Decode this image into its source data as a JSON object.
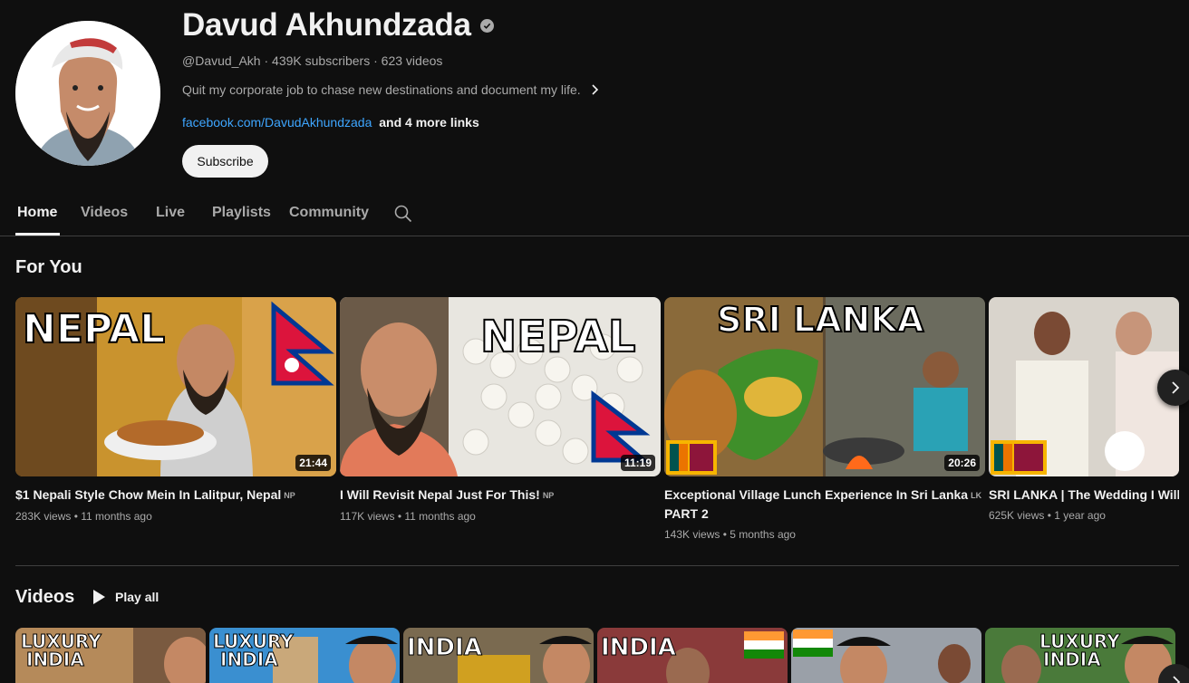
{
  "channel": {
    "name": "Davud Akhundzada",
    "handle": "@Davud_Akh",
    "subscribers": "439K subscribers",
    "videos_count": "623 videos",
    "description": "Quit my corporate job to chase new destinations and document my life.",
    "link": "facebook.com/DavudAkhundzada",
    "more_links": "and 4 more links",
    "subscribe_label": "Subscribe",
    "verified_icon": "verified-check-icon"
  },
  "tabs": [
    {
      "label": "Home",
      "active": true
    },
    {
      "label": "Videos"
    },
    {
      "label": "Live"
    },
    {
      "label": "Playlists"
    },
    {
      "label": "Community"
    }
  ],
  "for_you": {
    "title": "For You",
    "items": [
      {
        "title": "$1 Nepali Style Chow Mein In Lalitpur, Nepal",
        "cc": "NP",
        "views": "283K views",
        "age": "11 months ago",
        "duration": "21:44",
        "thumb_text": "NEPAL"
      },
      {
        "title": "I Will Revisit Nepal Just For This!",
        "cc": "NP",
        "views": "117K views",
        "age": "11 months ago",
        "duration": "11:19",
        "thumb_text": "NEPAL"
      },
      {
        "title": "Exceptional Village Lunch Experience In Sri Lanka",
        "cc": "LK",
        "title_line2": "PART 2",
        "views": "143K views",
        "age": "5 months ago",
        "duration": "20:26",
        "thumb_text": "SRI LANKA"
      },
      {
        "title": "SRI LANKA | The Wedding I Will N",
        "views": "625K views",
        "age": "1 year ago"
      }
    ]
  },
  "videos_section": {
    "title": "Videos",
    "play_all": "Play all",
    "thumbs": [
      {
        "text1": "LUXURY",
        "text2": "INDIA"
      },
      {
        "text1": "LUXURY",
        "text2": "INDIA"
      },
      {
        "text1": "INDIA",
        "text2": ""
      },
      {
        "text1": "INDIA",
        "text2": ""
      },
      {
        "text1": "",
        "text2": ""
      },
      {
        "text1": "LUXURY",
        "text2": "INDIA"
      }
    ]
  },
  "colors": {
    "background": "#0f0f0f",
    "link": "#3ea6ff",
    "text_secondary": "#aaaaaa"
  }
}
